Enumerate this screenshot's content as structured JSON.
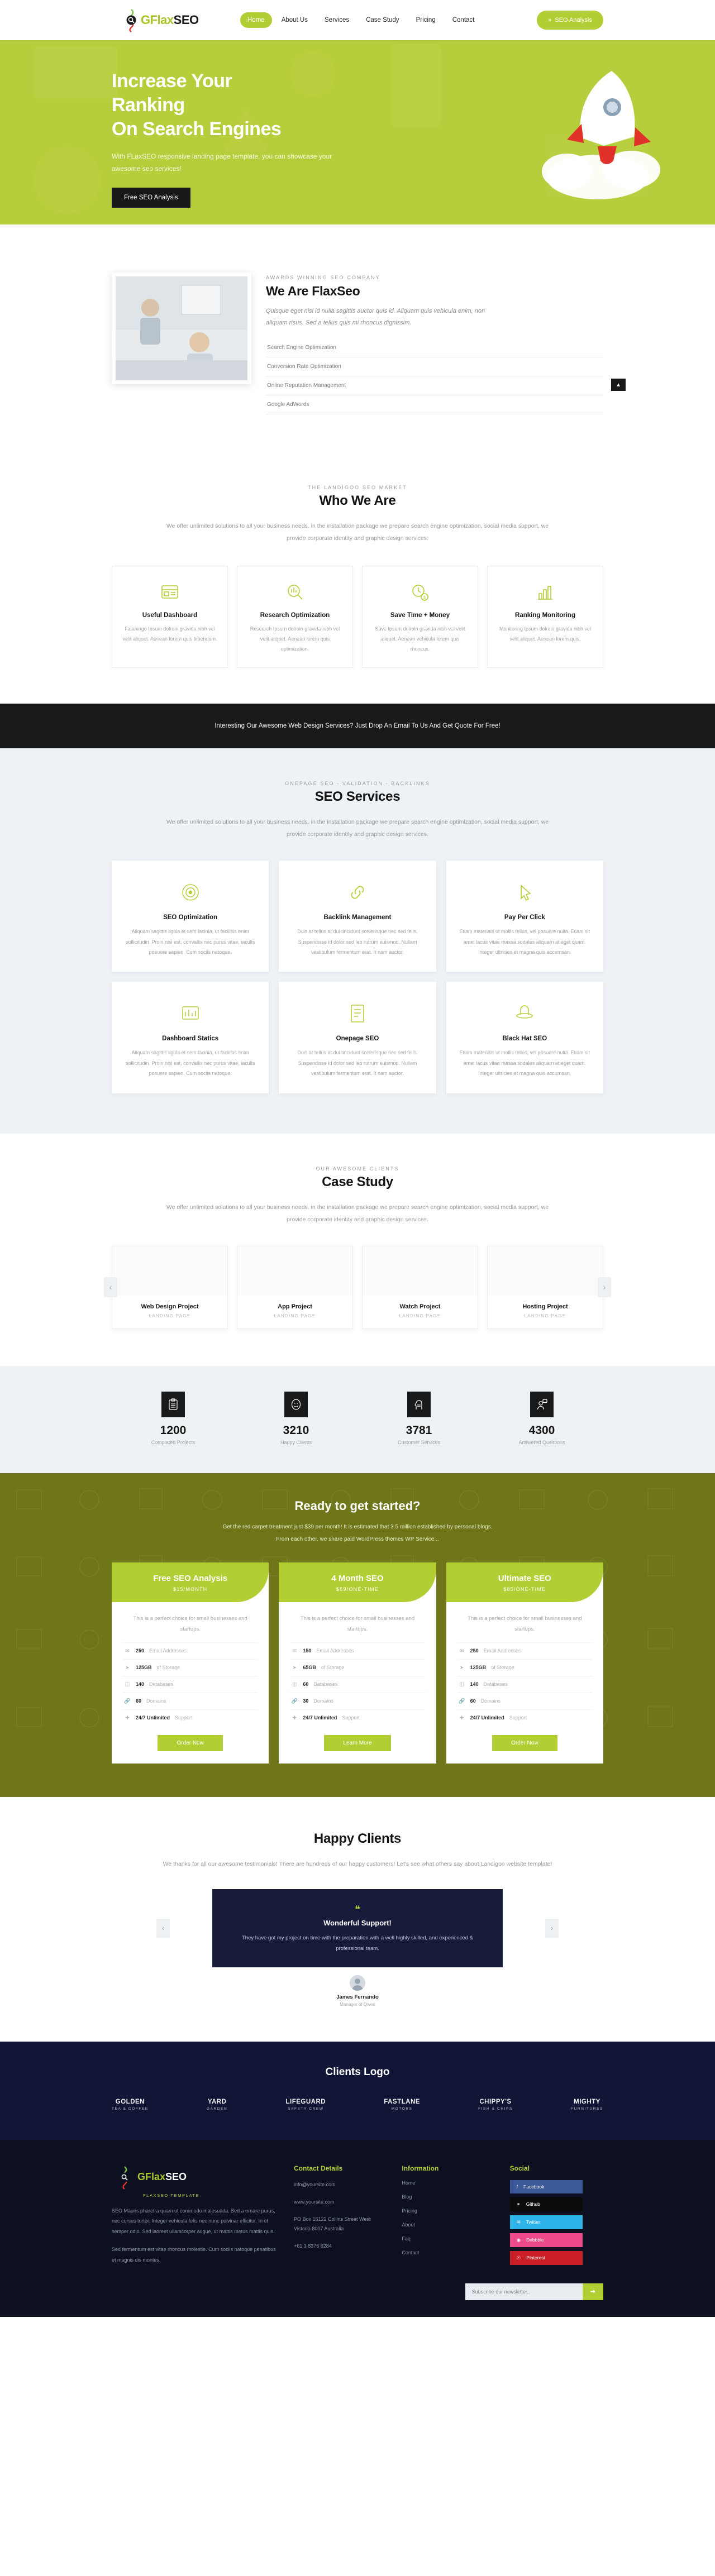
{
  "brand": {
    "name_parts": {
      "g": "G",
      "flax": "Flax",
      "seo": "SEO"
    },
    "tagline": "FLAXSEO TEMPLATE"
  },
  "header": {
    "nav": [
      {
        "label": "Home",
        "active": true
      },
      {
        "label": "About Us",
        "active": false
      },
      {
        "label": "Services",
        "active": false
      },
      {
        "label": "Case Study",
        "active": false
      },
      {
        "label": "Pricing",
        "active": false
      },
      {
        "label": "Contact",
        "active": false
      }
    ],
    "cta_label": "SEO Analysis",
    "cta_icon": "double-chevron-right-icon"
  },
  "hero": {
    "title_line1": "Increase Your",
    "title_line2": "Ranking",
    "title_line3": "On Search Engines",
    "subtitle": "With FLaxSEO responsive landing page template, you can showcase your awesome seo services!",
    "button_label": "Free SEO Analysis"
  },
  "about": {
    "eyebrow": "AWARDS WINNING SEO COMPANY",
    "title": "We Are FlaxSeo",
    "lead": "Quisque eget nisl id nulla sagittis auctor quis id. Aliquam quis vehicula enim, non aliquam risus. Sed a tellus quis mi rhoncus dignissim.",
    "items": [
      "Search Engine Optimization",
      "Conversion Rate Optimization",
      "Online Reputation Management",
      "Google AdWords"
    ]
  },
  "whoweare": {
    "eyebrow": "THE LANDIGOO SEO MARKET",
    "title": "Who We Are",
    "subtitle": "We offer unlimited solutions to all your business needs. in the installation package we prepare search engine optimization, social media support, we provide corporate identity and graphic design services.",
    "cards": [
      {
        "icon": "dashboard-icon",
        "title": "Useful Dashboard",
        "text": "Falaningo Ipsum dolroin gravida nibh vel velit aliquet. Aenean lorem quis bibendum."
      },
      {
        "icon": "magnifier-chart-icon",
        "title": "Research Optimization",
        "text": "Research Ipsum dolroin gravida nibh vel velit aliquet. Aenean lorem quis optimization."
      },
      {
        "icon": "clock-coin-icon",
        "title": "Save Time + Money",
        "text": "Save Ipsum dolroin gravida nibh vel velit aliquet. Aenean vehicula lorem quis rhoncus."
      },
      {
        "icon": "ranking-bars-icon",
        "title": "Ranking Monitoring",
        "text": "Monitoring Ipsum dolroin gravida nibh vel velit aliquet. Aenean lorem quis."
      }
    ]
  },
  "dark_cta": {
    "text": "Interesting Our Awesome Web Design Services? Just Drop An Email To Us And Get Quote For Free!"
  },
  "services": {
    "eyebrow": "ONEPAGE SEO - VALIDATION - BACKLINKS",
    "title": "SEO Services",
    "subtitle": "We offer unlimited solutions to all your business needs. in the installation package we prepare search engine optimization, social media support, we provide corporate identity and graphic design services.",
    "cards": [
      {
        "icon": "seo-target-icon",
        "title": "SEO Optimization",
        "text": "Aliquam sagittis ligula et sem lacinia, ut facilisis enim sollicitudin. Proin nisi est, convallis nec purus vitae, iaculis posuere sapien. Cum sociis natoque."
      },
      {
        "icon": "link-chain-icon",
        "title": "Backlink Management",
        "text": "Duis at tellus at dui tincidunt scelerisque nec sed felis. Suspendisse id dolor sed leo rutrum euismod. Nullam vestibulum fermentum erat. It nam auctor."
      },
      {
        "icon": "cursor-click-icon",
        "title": "Pay Per Click",
        "text": "Etiam materials ut mollis tellus, vel posuere nulla. Etiam sit amet lacus vitae massa sodales aliquam at eget quam. Integer ultricies et magna quis accumsan."
      },
      {
        "icon": "dashboard-statics-icon",
        "title": "Dashboard Statics",
        "text": "Aliquam sagittis ligula et sem lacinia, ut facilisis enim sollicitudin. Proin nisi est, convallis nec purus vitae, iaculis posuere sapien. Cum sociis natoque."
      },
      {
        "icon": "onepage-doc-icon",
        "title": "Onepage SEO",
        "text": "Duis at tellus at dui tincidunt scelerisque nec sed felis. Suspendisse id dolor sed leo rutrum euismod. Nullam vestibulum fermentum erat. It nam auctor."
      },
      {
        "icon": "black-hat-icon",
        "title": "Black Hat SEO",
        "text": "Etiam materials ut mollis tellus, vel posuere nulla. Etiam sit amet lacus vitae massa sodales aliquam at eget quam. Integer ultricies et magna quis accumsan."
      }
    ]
  },
  "casestudy": {
    "eyebrow": "OUR AWESOME CLIENTS",
    "title": "Case Study",
    "subtitle": "We offer unlimited solutions to all your business needs. in the installation package we prepare search engine optimization, social media support, we provide corporate identity and graphic design services.",
    "prev_icon": "chevron-left-icon",
    "next_icon": "chevron-right-icon",
    "items": [
      {
        "title": "Web Design Project",
        "tag": "LANDING PAGE"
      },
      {
        "title": "App Project",
        "tag": "LANDING PAGE"
      },
      {
        "title": "Watch Project",
        "tag": "LANDING PAGE"
      },
      {
        "title": "Hosting Project",
        "tag": "LANDING PAGE"
      }
    ]
  },
  "counters": [
    {
      "icon": "clipboard-icon",
      "value": "1200",
      "label": "Complated Projects"
    },
    {
      "icon": "smiley-face-icon",
      "value": "3210",
      "label": "Happy Clients"
    },
    {
      "icon": "head-gear-icon",
      "value": "3781",
      "label": "Customer Services"
    },
    {
      "icon": "user-chat-icon",
      "value": "4300",
      "label": "Answered Questions"
    }
  ],
  "pricing": {
    "title": "Ready to get started?",
    "subtitle_line1": "Get the red carpet treatment just $39 per month! It is estimated that 3.5 million established by personal blogs.",
    "subtitle_line2": "From each other, we share paid WordPress themes WP Service...",
    "plans": [
      {
        "name": "Free SEO Analysis",
        "amount": "$15/MONTH",
        "desc": "This is a perfect choice for small businesses and startups.",
        "features": [
          {
            "icon": "envelope-icon",
            "value": "250",
            "label": "Email Addresses"
          },
          {
            "icon": "paper-plane-icon",
            "value": "125GB",
            "label": "of Storage"
          },
          {
            "icon": "database-icon",
            "value": "140",
            "label": "Databases"
          },
          {
            "icon": "link-icon",
            "value": "60",
            "label": "Domains"
          },
          {
            "icon": "lifebuoy-icon",
            "value": "24/7 Unlimited",
            "label": "Support"
          }
        ],
        "button_label": "Order Now"
      },
      {
        "name": "4 Month SEO",
        "amount": "$59/ONE-TIME",
        "desc": "This is a perfect choice for small businesses and startups.",
        "features": [
          {
            "icon": "envelope-icon",
            "value": "150",
            "label": "Email Addresses"
          },
          {
            "icon": "paper-plane-icon",
            "value": "65GB",
            "label": "of Storage"
          },
          {
            "icon": "database-icon",
            "value": "60",
            "label": "Databases"
          },
          {
            "icon": "link-icon",
            "value": "30",
            "label": "Domains"
          },
          {
            "icon": "lifebuoy-icon",
            "value": "24/7 Unlimited",
            "label": "Support"
          }
        ],
        "button_label": "Learn More"
      },
      {
        "name": "Ultimate SEO",
        "amount": "$85/ONE-TIME",
        "desc": "This is a perfect choice for small businesses and startups.",
        "features": [
          {
            "icon": "envelope-icon",
            "value": "250",
            "label": "Email Addresses"
          },
          {
            "icon": "paper-plane-icon",
            "value": "125GB",
            "label": "of Storage"
          },
          {
            "icon": "database-icon",
            "value": "140",
            "label": "Databases"
          },
          {
            "icon": "link-icon",
            "value": "60",
            "label": "Domains"
          },
          {
            "icon": "lifebuoy-icon",
            "value": "24/7 Unlimited",
            "label": "Support"
          }
        ],
        "button_label": "Order Now"
      }
    ]
  },
  "happy": {
    "title": "Happy Clients",
    "subtitle": "We thanks for all our awesome testimonials! There are hundreds of our happy customers! Let's see what others say about Landigoo website template!",
    "prev_icon": "chevron-left-icon",
    "next_icon": "chevron-right-icon",
    "quote_icon": "quote-icon",
    "headline": "Wonderful Support!",
    "body": "They have got my project on time with the preparation with a well highly skilled, and experienced & professional team.",
    "author_name": "James Fernando",
    "author_role": "Manager of Qweri"
  },
  "clients_logo": {
    "title": "Clients Logo",
    "logos": [
      {
        "line1": "GOLDEN",
        "line2": "TEA & COFFEE"
      },
      {
        "line1": "YARD",
        "line2": "GARDEN"
      },
      {
        "line1": "LIFEGUARD",
        "line2": "SAFETY CREW"
      },
      {
        "line1": "FASTLANE",
        "line2": "MOTORS"
      },
      {
        "line1": "CHIPPY'S",
        "line2": "FISH & CHIPS"
      },
      {
        "line1": "MIGHTY",
        "line2": "FURNITURES"
      }
    ]
  },
  "footer": {
    "about_text_1": "SEO Mauris pharetra quam ut commodo malesuada. Sed a ornare purus, nec cursus tortor. Integer vehicula felis nec nunc pulvinar efficitur. In et semper odio. Sed laoreet ullamcorper augue, ut mattis metus mattis quis.",
    "about_text_2": "Sed fermentum est vitae rhoncus molestie. Cum sociis natoque penatibus et magnis dis montes.",
    "contact": {
      "title": "Contact Details",
      "email": "info@yoursite.com",
      "website": "www.yoursite.com",
      "address": "PO Box 16122 Collins Street West Victoria 8007 Australia",
      "phone": "+61 3 8376 6284"
    },
    "information": {
      "title": "Information",
      "links": [
        "Home",
        "Blog",
        "Pricing",
        "About",
        "Faq",
        "Contact"
      ]
    },
    "social": {
      "title": "Social",
      "items": [
        {
          "name": "Facebook",
          "icon": "facebook-icon",
          "color": "#3b5998"
        },
        {
          "name": "Github",
          "icon": "github-icon",
          "color": "#0b0b0b"
        },
        {
          "name": "Twitter",
          "icon": "twitter-icon",
          "color": "#2fb4e9"
        },
        {
          "name": "Dribbble",
          "icon": "dribbble-icon",
          "color": "#ec4a89"
        },
        {
          "name": "Pinterest",
          "icon": "pinterest-icon",
          "color": "#cb2027"
        }
      ]
    },
    "newsletter_placeholder": "Subscribe our newsletter..",
    "newsletter_button_icon": "arrow-right-icon"
  },
  "colors": {
    "accent": "#b2ce35",
    "dark": "#17191b",
    "navy": "#111637",
    "olive": "#6e7619"
  }
}
